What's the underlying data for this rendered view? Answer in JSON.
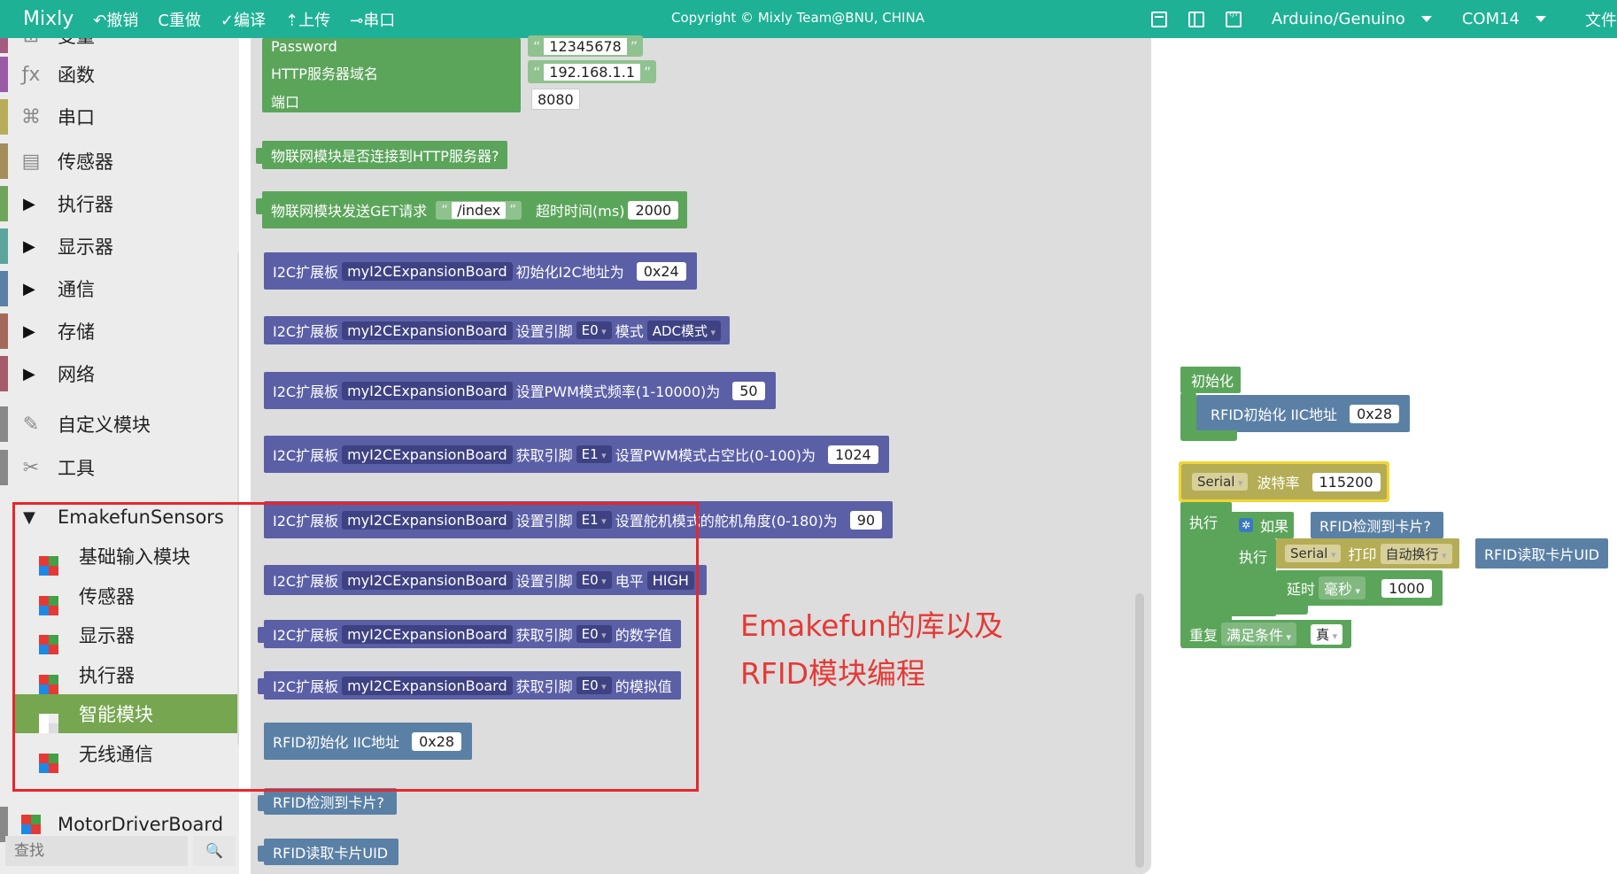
{
  "topbar": {
    "brand": "Mixly",
    "undo": "↶撤销",
    "redo": "C重做",
    "compile": "✓编译",
    "upload": "⇡上传",
    "serial": "⊸串口",
    "copyright": "Copyright © Mixly Team@BNU, CHINA",
    "board": "Arduino/Genuino",
    "port": "COM14",
    "file": "文件"
  },
  "sidebar": {
    "categories": [
      {
        "label": "变量",
        "color": "#a55b80"
      },
      {
        "label": "函数",
        "color": "#995ba5"
      },
      {
        "label": "串口",
        "color": "#b8ad5b"
      },
      {
        "label": "传感器",
        "color": "#a58c5b"
      },
      {
        "label": "执行器",
        "color": "#6fa55b"
      },
      {
        "label": "显示器",
        "color": "#5ba59e"
      },
      {
        "label": "通信",
        "color": "#5b80a5"
      },
      {
        "label": "存储",
        "color": "#a5695b"
      },
      {
        "label": "网络",
        "color": "#a55b6b"
      },
      {
        "label": "自定义模块",
        "color": "#888888"
      },
      {
        "label": "工具",
        "color": "#888888"
      }
    ],
    "group": "EmakefunSensors",
    "subitems": [
      "基础输入模块",
      "传感器",
      "显示器",
      "执行器",
      "智能模块",
      "无线通信"
    ],
    "motor": "MotorDriverBoard",
    "search_placeholder": "查找",
    "search_icon": "🔍"
  },
  "flyout": {
    "password_label": "Password",
    "password_value": "12345678",
    "http_label": "HTTP服务器域名",
    "http_value": "192.168.1.1",
    "port_label": "端口",
    "port_value": "8080",
    "iot_connected": "物联网模块是否连接到HTTP服务器?",
    "get_label": "物联网模块发送GET请求",
    "get_path": "/index",
    "timeout_label": "超时时间(ms)",
    "timeout_value": "2000",
    "i2c": "I2C扩展板",
    "board_name": "myI2CExpansionBoard",
    "init_addr": "初始化I2C地址为",
    "init_addr_value": "0x24",
    "set_pin": "设置引脚",
    "get_pin": "获取引脚",
    "pin_e0": "E0",
    "pin_e1": "E1",
    "mode_label": "模式",
    "mode_value": "ADC模式",
    "pwm_freq": "设置PWM模式频率(1-10000)为",
    "pwm_freq_value": "50",
    "pwm_duty": "设置PWM模式占空比(0-100)为",
    "pwm_duty_value": "1024",
    "servo": "设置舵机模式的舵机角度(0-180)为",
    "servo_value": "90",
    "level_label": "电平",
    "level_value": "HIGH",
    "digital": "的数字值",
    "analog": "的模拟值",
    "rfid_init": "RFID初始化 IIC地址",
    "rfid_addr": "0x28",
    "rfid_detect": "RFID检测到卡片?",
    "rfid_uid": "RFID读取卡片UID"
  },
  "workspace": {
    "init_label": "初始化",
    "rfid_init": "RFID初始化 IIC地址",
    "rfid_addr": "0x28",
    "serial": "Serial",
    "baud_label": "波特率",
    "baud_value": "115200",
    "exec": "执行",
    "if_label": "如果",
    "rfid_detect": "RFID检测到卡片?",
    "print_label": "打印",
    "newline": "自动换行",
    "rfid_uid": "RFID读取卡片UID",
    "delay_label": "延时",
    "ms": "毫秒",
    "delay_value": "1000",
    "repeat": "重复",
    "until": "满足条件",
    "true_val": "真"
  },
  "annotation": {
    "line1": "Emakefun的库以及",
    "line2": "RFID模块编程"
  }
}
